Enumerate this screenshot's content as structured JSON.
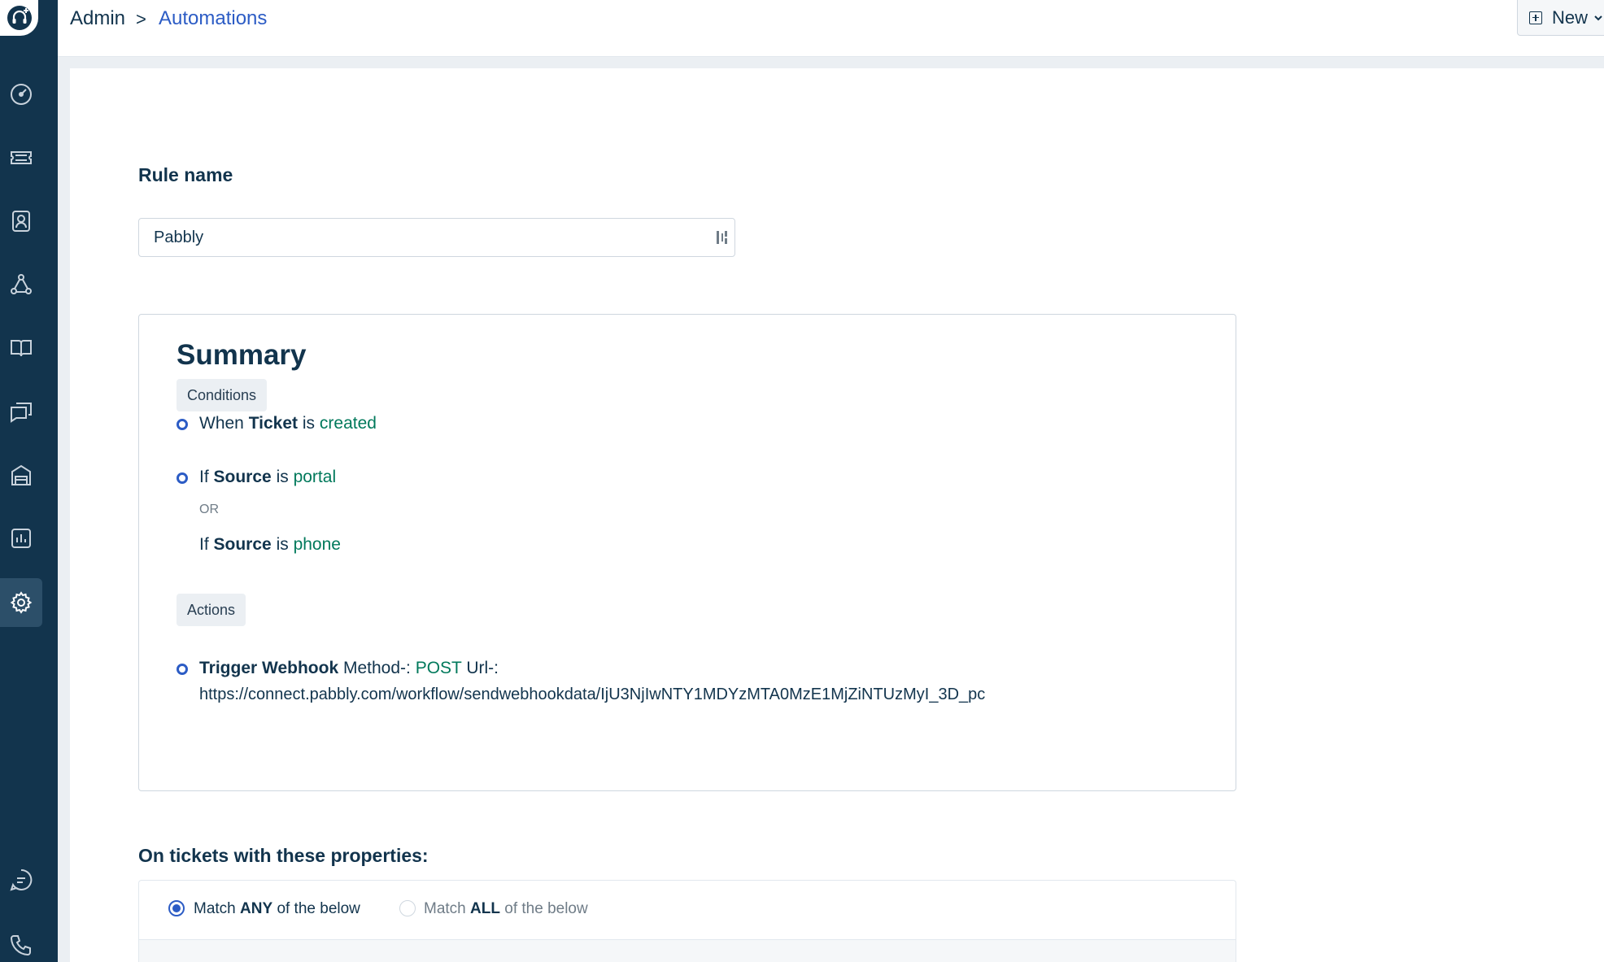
{
  "header": {
    "breadcrumb_root": "Admin",
    "breadcrumb_separator": ">",
    "breadcrumb_current": "Automations",
    "new_button_label": "New"
  },
  "sidebar": {
    "icons": [
      "logo-headset-icon",
      "dashboard-icon",
      "tickets-icon",
      "contacts-icon",
      "groups-icon",
      "solutions-icon",
      "forums-icon",
      "assets-icon",
      "reports-icon",
      "admin-gear-icon",
      "chat-icon",
      "phone-icon"
    ],
    "active": "admin-gear-icon"
  },
  "form": {
    "rule_name_label": "Rule name",
    "rule_name_value": "Pabbly"
  },
  "summary": {
    "title": "Summary",
    "conditions_label": "Conditions",
    "event": {
      "when": "When",
      "object": "Ticket",
      "is": "is",
      "value": "created"
    },
    "condition_1": {
      "if": "If",
      "field": "Source",
      "is": "is",
      "value": "portal"
    },
    "or_label": "OR",
    "condition_2": {
      "if": "If",
      "field": "Source",
      "is": "is",
      "value": "phone"
    },
    "actions_label": "Actions",
    "action": {
      "name": "Trigger Webhook",
      "method_label": "Method-:",
      "method_value": "POST",
      "url_label": "Url-:",
      "url_value": "https://connect.pabbly.com/workflow/sendwebhookdata/IjU3NjIwNTY1MDYzMTA0MzE1MjZiNTUzMyI_3D_pc"
    }
  },
  "properties": {
    "heading": "On tickets with these properties:",
    "match_any": {
      "prefix": "Match",
      "keyword": "ANY",
      "suffix": "of the below",
      "selected": true
    },
    "match_all": {
      "prefix": "Match",
      "keyword": "ALL",
      "suffix": "of the below",
      "selected": false
    }
  },
  "colors": {
    "sidebar_bg": "#12344d",
    "link_blue": "#2c5cc5",
    "value_green": "#00795b"
  }
}
